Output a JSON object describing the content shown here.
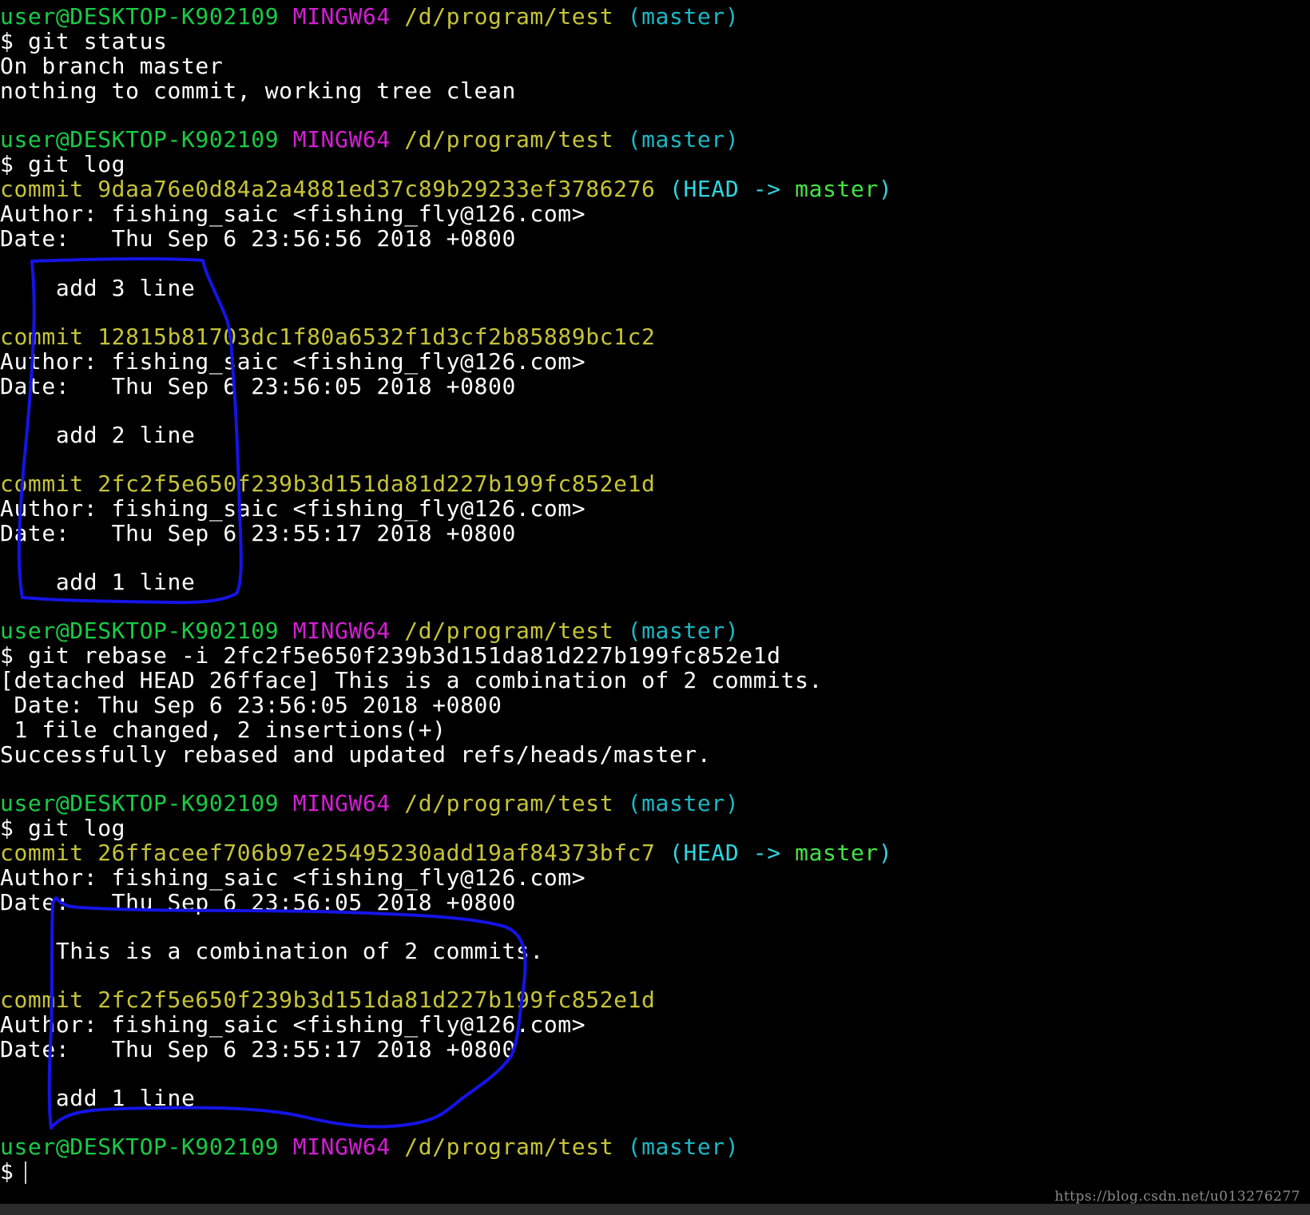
{
  "prompt": {
    "user_host": "user@DESKTOP-K902109",
    "system": "MINGW64",
    "path": "/d/program/test",
    "branch": "(master)",
    "symbol": "$"
  },
  "blocks": {
    "b1": {
      "command": "git status",
      "out1": "On branch master",
      "out2": "nothing to commit, working tree clean"
    },
    "b2": {
      "command": "git log",
      "commits": [
        {
          "label": "commit",
          "hash": "9daa76e0d84a2a4881ed37c89b29233ef3786276",
          "refs_open": "(",
          "refs_head": "HEAD ->",
          "refs_branch": "master",
          "refs_close": ")",
          "author": "Author: fishing_saic <fishing_fly@126.com>",
          "date": "Date:   Thu Sep 6 23:56:56 2018 +0800",
          "message": "    add 3 line"
        },
        {
          "label": "commit",
          "hash": "12815b81703dc1f80a6532f1d3cf2b85889bc1c2",
          "author": "Author: fishing_saic <fishing_fly@126.com>",
          "date": "Date:   Thu Sep 6 23:56:05 2018 +0800",
          "message": "    add 2 line"
        },
        {
          "label": "commit",
          "hash": "2fc2f5e650f239b3d151da81d227b199fc852e1d",
          "author": "Author: fishing_saic <fishing_fly@126.com>",
          "date": "Date:   Thu Sep 6 23:55:17 2018 +0800",
          "message": "    add 1 line"
        }
      ]
    },
    "b3": {
      "command": "git rebase -i 2fc2f5e650f239b3d151da81d227b199fc852e1d",
      "out1": "[detached HEAD 26fface] This is a combination of 2 commits.",
      "out2": " Date: Thu Sep 6 23:56:05 2018 +0800",
      "out3": " 1 file changed, 2 insertions(+)",
      "out4": "Successfully rebased and updated refs/heads/master."
    },
    "b4": {
      "command": "git log",
      "commits": [
        {
          "label": "commit",
          "hash": "26ffaceef706b97e25495230add19af84373bfc7",
          "refs_open": "(",
          "refs_head": "HEAD ->",
          "refs_branch": "master",
          "refs_close": ")",
          "author": "Author: fishing_saic <fishing_fly@126.com>",
          "date": "Date:   Thu Sep 6 23:56:05 2018 +0800",
          "message": "    This is a combination of 2 commits."
        },
        {
          "label": "commit",
          "hash": "2fc2f5e650f239b3d151da81d227b199fc852e1d",
          "author": "Author: fishing_saic <fishing_fly@126.com>",
          "date": "Date:   Thu Sep 6 23:55:17 2018 +0800",
          "message": "    add 1 line"
        }
      ]
    }
  },
  "watermark": "https://blog.csdn.net/u013276277",
  "colors": {
    "background": "#000000",
    "text": "#ffffff",
    "user_host": "#19cc47",
    "system": "#d41ed4",
    "path": "#c7c437",
    "branch": "#1cb8c4",
    "commit_hash": "#c7c437",
    "head_ref": "#2ed6e0",
    "master_ref": "#44e344",
    "annotation": "#1414e6"
  }
}
